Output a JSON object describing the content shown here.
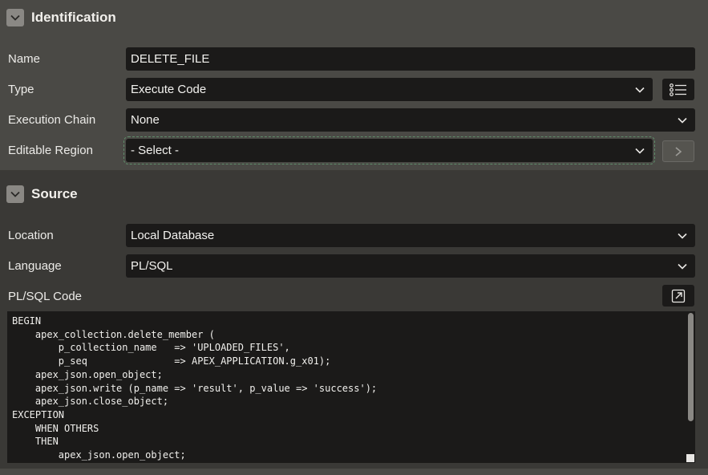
{
  "identification": {
    "title": "Identification",
    "name_label": "Name",
    "name_value": "DELETE_FILE",
    "type_label": "Type",
    "type_value": "Execute Code",
    "chain_label": "Execution Chain",
    "chain_value": "None",
    "region_label": "Editable Region",
    "region_value": "- Select -"
  },
  "source": {
    "title": "Source",
    "location_label": "Location",
    "location_value": "Local Database",
    "language_label": "Language",
    "language_value": "PL/SQL",
    "code_label": "PL/SQL Code",
    "code_lines": [
      "BEGIN",
      "    apex_collection.delete_member (",
      "        p_collection_name   => 'UPLOADED_FILES',",
      "        p_seq               => APEX_APPLICATION.g_x01);",
      "    apex_json.open_object;",
      "    apex_json.write (p_name => 'result', p_value => 'success');",
      "    apex_json.close_object;",
      "EXCEPTION",
      "    WHEN OTHERS",
      "    THEN",
      "        apex_json.open_object;"
    ]
  },
  "icons": {
    "collapse": "chevron-down-icon",
    "list": "list-icon",
    "arrow": "chevron-right-icon",
    "expand": "expand-icon"
  }
}
